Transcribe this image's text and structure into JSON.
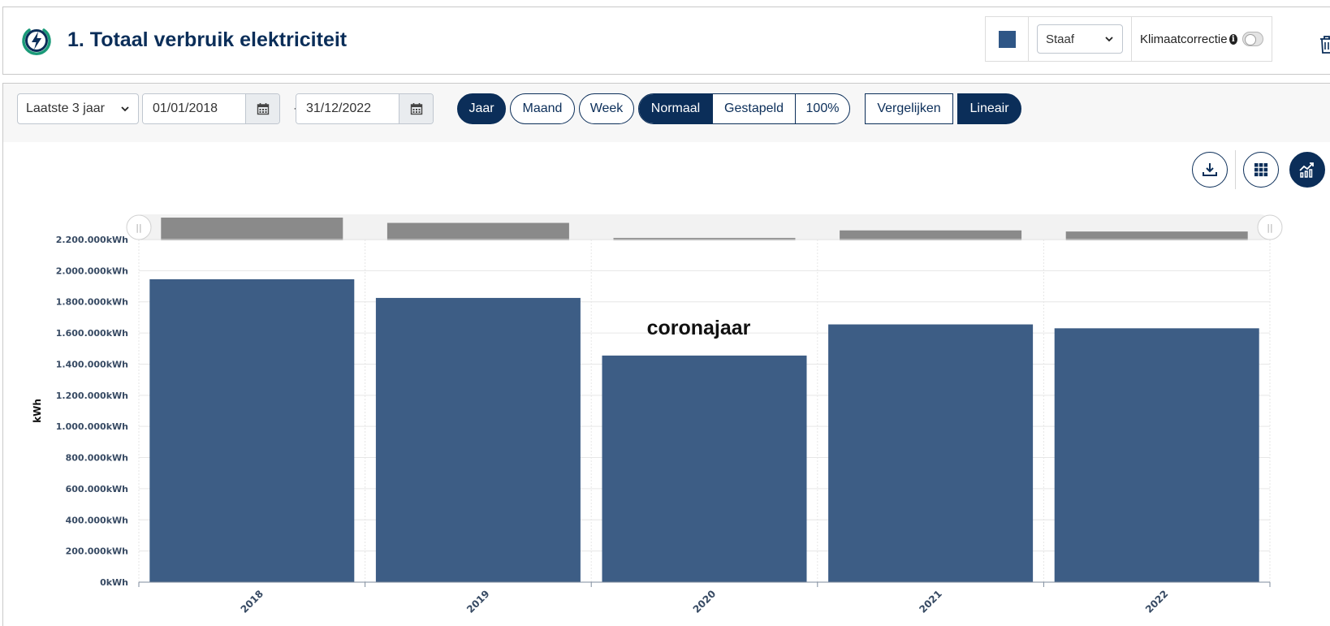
{
  "header": {
    "title": "1. Totaal verbruik elektriciteit",
    "series_color": "#2f5686",
    "chart_type_value": "Staaf",
    "klimaat_label": "Klimaatcorrectie",
    "klimaat_enabled": false,
    "icons": [
      "lightning-icon",
      "info-icon",
      "trash-icon"
    ]
  },
  "toolbar": {
    "period_value": "Laatste 3 jaar",
    "date_from": "01/01/2018",
    "date_to": "31/12/2022",
    "date_separator": "-",
    "granularity": [
      {
        "label": "Jaar",
        "active": true
      },
      {
        "label": "Maand",
        "active": false
      },
      {
        "label": "Week",
        "active": false
      }
    ],
    "stack_modes": [
      {
        "label": "Normaal",
        "active": true
      },
      {
        "label": "Gestapeld",
        "active": false
      },
      {
        "label": "100%",
        "active": false
      }
    ],
    "compare_label": "Vergelijken",
    "linear_label": "Lineair"
  },
  "chart_actions": [
    "download-icon",
    "grid-icon",
    "chart-icon"
  ],
  "chart_data": {
    "type": "bar",
    "title": "",
    "xlabel": "",
    "ylabel": "kWh",
    "categories": [
      "2018",
      "2019",
      "2020",
      "2021",
      "2022"
    ],
    "values": [
      1945000,
      1825000,
      1455000,
      1655000,
      1630000
    ],
    "ylim": [
      0,
      2200000
    ],
    "yticks": [
      "0kWh",
      "200.000kWh",
      "400.000kWh",
      "600.000kWh",
      "800.000kWh",
      "1.000.000kWh",
      "1.200.000kWh",
      "1.400.000kWh",
      "1.600.000kWh",
      "1.800.000kWh",
      "2.000.000kWh",
      "2.200.000kWh"
    ],
    "annotation": {
      "text": "coronajaar",
      "category": "2020"
    },
    "bar_color": "#3d5d85",
    "navigator_color": "#8a8a8a",
    "grid": true,
    "legend": "none"
  }
}
